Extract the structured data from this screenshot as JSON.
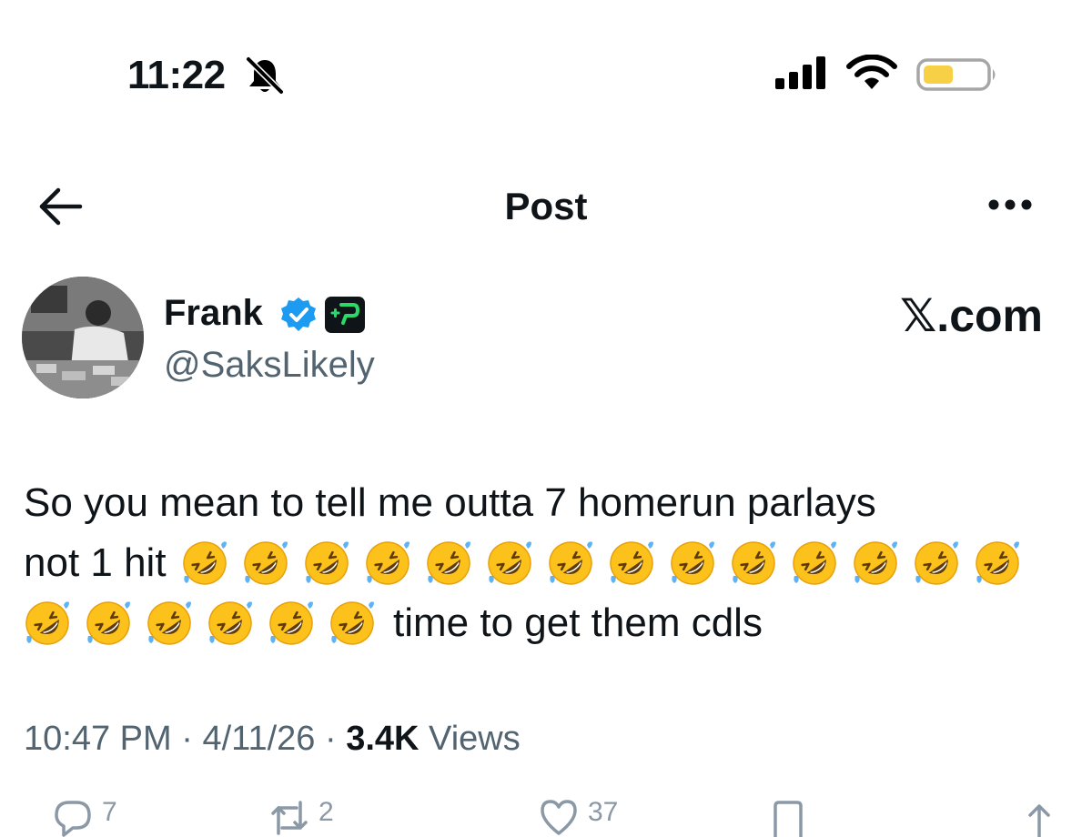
{
  "status_bar": {
    "time": "11:22"
  },
  "header": {
    "title": "Post"
  },
  "author": {
    "name": "Frank",
    "handle": "@SaksLikely"
  },
  "watermark": "𝕏.com",
  "post": {
    "line1": "So you mean to tell me outta 7 homerun parlays",
    "line2_prefix": "not 1 hit",
    "line3_suffix": "time to get them cdls",
    "emoji_count_line2": 14,
    "emoji_count_line3": 6,
    "emoji": "🤣"
  },
  "meta": {
    "time": "10:47 PM",
    "separator": "·",
    "date": "4/11/26",
    "views_count": "3.4K",
    "views_label": "Views"
  },
  "actions": {
    "replies": "7",
    "reposts": "2",
    "likes": "37"
  },
  "colors": {
    "accent": "#1d9bf0",
    "battery": "#f7d046",
    "muted": "#536471"
  }
}
